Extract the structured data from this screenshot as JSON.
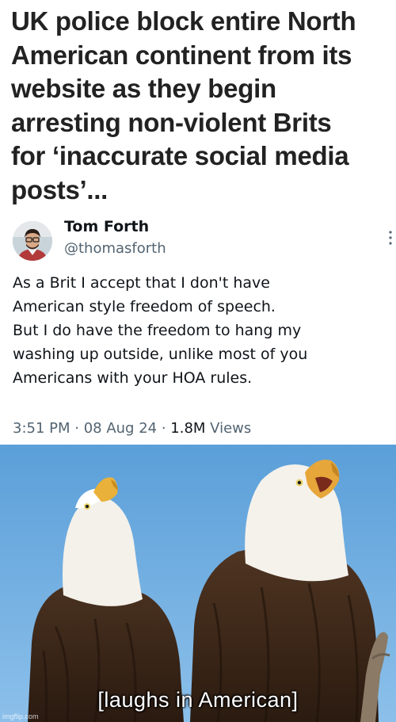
{
  "headline": {
    "lines": [
      "UK police block entire North",
      "American continent from its",
      "website as they begin",
      "arresting non-violent Brits",
      "for ‘inaccurate social media",
      "posts’..."
    ]
  },
  "tweet": {
    "author_name": "Tom Forth",
    "author_handle": "@thomasforth",
    "text_lines": [
      "As a Brit I accept that I don't have",
      "American style freedom of speech.",
      "But I do have the freedom to hang my",
      "washing up outside, unlike most of you",
      "Americans with your HOA rules."
    ],
    "time": "3:51 PM",
    "date": "08 Aug 24",
    "views_count": "1.8M",
    "views_label": "Views"
  },
  "meme": {
    "caption": "[laughs in American]",
    "watermark": "imgflip.com"
  }
}
